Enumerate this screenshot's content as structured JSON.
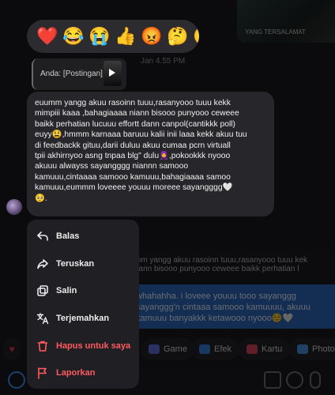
{
  "background": {
    "top_image_caption": "YANG TERSALAMAT",
    "timestamp": "Jan 4.55 PM",
    "quoted_lines": [
      "mm yangg akuu rasoinn tuuu,rasanyooo tuuu kek",
      "nann bisooo punyooo ceweee baikk perhatian l"
    ],
    "sent_lines": [
      "whahahha. i loveee youuu tooo sayanggg",
      "sayanggg'n cintaaa samooo kamuuuu, akuuu",
      "kamuuu banyakkk ketawooo nyooo☺️🤍"
    ],
    "chips": [
      "Game",
      "Efek",
      "Kartu",
      "PhotoS"
    ]
  },
  "reactions": [
    "❤️",
    "😂",
    "😭",
    "👍",
    "😡",
    "🤔",
    "😮"
  ],
  "story_reply": {
    "label": "Anda: [Postingan]"
  },
  "message": {
    "lines": [
      "euumm yangg akuu rasoinn tuuu,rasanyooo tuuu kekk",
      "mimpiii kaaa ,bahagiaaaa niann bisooo punyooo ceweee",
      "baikk perhatian lucuuu effortt dann canpol(cantikkk poll)",
      "euyy😫,hmmm karnaaa baruuu kalii inii laaa kekk akuu tuu",
      "di feedbackk gituu,darii duluu akuu cumaa pcrn virtuall",
      "tpii akhirnyoo asng tnpaa blg\" dulu🧕,pokookkk nyooo",
      "akuuu alwayss sayangggg niannn samooo",
      "kamuuu,cintaaaa samooo kamuuu,bahagiaaaa samoo",
      "kamuuu,eummm loveeee youuu moreee sayangggg🤍",
      "🥺."
    ]
  },
  "menu": {
    "items": [
      {
        "label": "Balas",
        "icon": "reply-icon",
        "danger": false
      },
      {
        "label": "Teruskan",
        "icon": "forward-icon",
        "danger": false
      },
      {
        "label": "Salin",
        "icon": "copy-icon",
        "danger": false
      },
      {
        "label": "Terjemahkan",
        "icon": "translate-icon",
        "danger": false
      },
      {
        "label": "Hapus untuk saya",
        "icon": "trash-icon",
        "danger": true
      },
      {
        "label": "Laporkan",
        "icon": "flag-icon",
        "danger": true
      }
    ]
  },
  "colors": {
    "danger": "#ff5a5f",
    "bubble": "#27272b",
    "menu": "#202024",
    "sent_bubble": "#2a63b8"
  }
}
